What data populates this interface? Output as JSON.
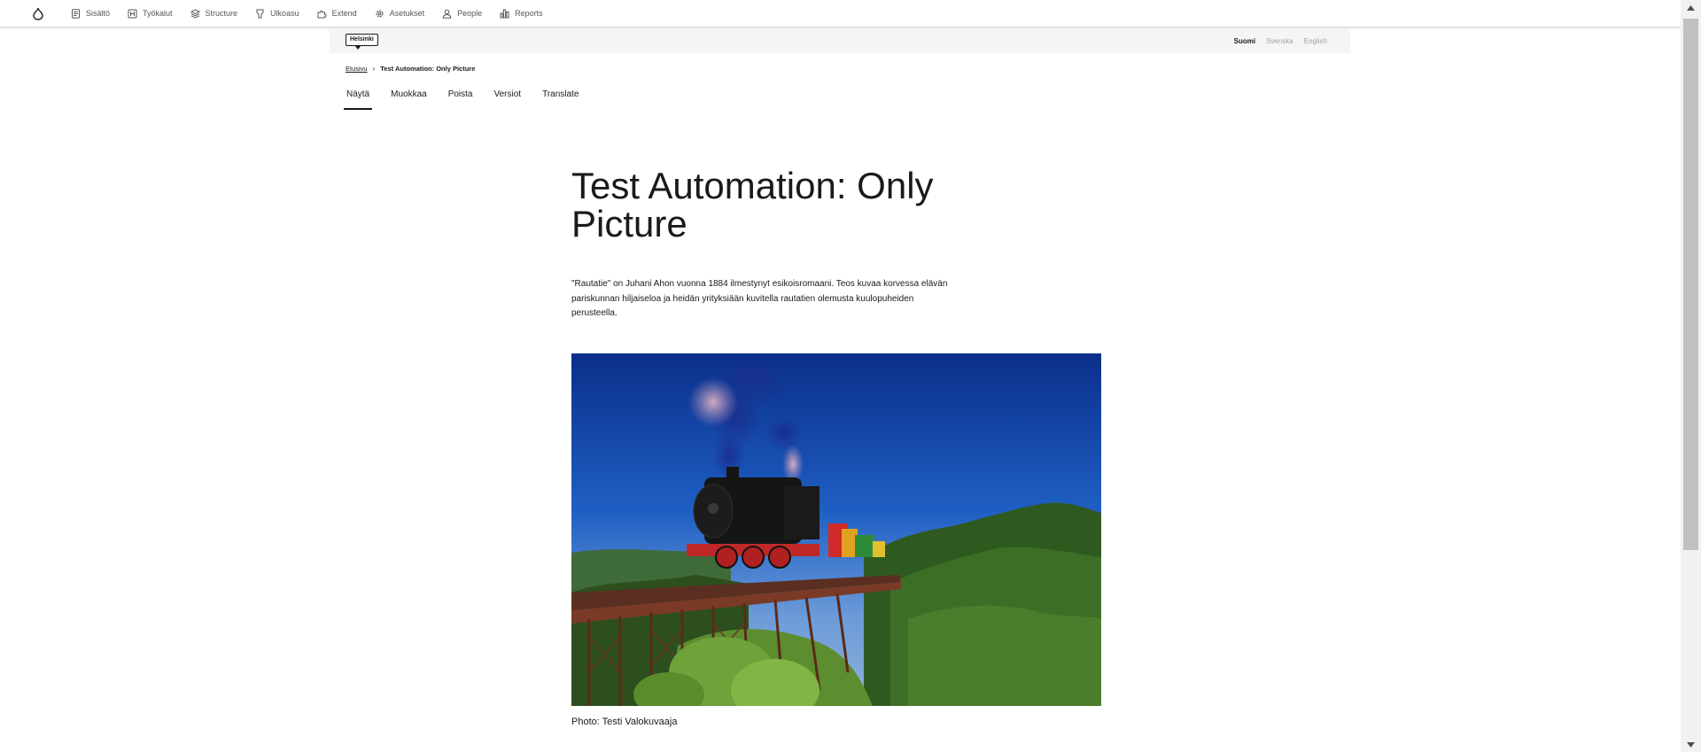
{
  "toolbar": {
    "items": [
      {
        "label": "Sisältö",
        "icon": "file-text-icon"
      },
      {
        "label": "Työkalut",
        "icon": "tools-icon"
      },
      {
        "label": "Structure",
        "icon": "structure-icon"
      },
      {
        "label": "Ulkoasu",
        "icon": "brush-icon"
      },
      {
        "label": "Extend",
        "icon": "puzzle-icon"
      },
      {
        "label": "Asetukset",
        "icon": "gear-icon"
      },
      {
        "label": "People",
        "icon": "person-icon"
      },
      {
        "label": "Reports",
        "icon": "bar-chart-icon"
      }
    ]
  },
  "site": {
    "brand": "Helsinki",
    "languages": [
      {
        "label": "Suomi",
        "active": true
      },
      {
        "label": "Svenska",
        "active": false
      },
      {
        "label": "English",
        "active": false
      }
    ]
  },
  "breadcrumb": {
    "home": "Etusivu",
    "current": "Test Automation: Only Picture"
  },
  "tabs": [
    {
      "label": "Näytä",
      "active": true
    },
    {
      "label": "Muokkaa",
      "active": false
    },
    {
      "label": "Poista",
      "active": false
    },
    {
      "label": "Versiot",
      "active": false
    },
    {
      "label": "Translate",
      "active": false
    }
  ],
  "page": {
    "title": "Test Automation: Only Picture",
    "lead": "\"Rautatie\" on Juhani Ahon vuonna 1884 ilmestynyt esikoisromaani. Teos kuvaa korvessa elävän pariskunnan hiljaiseloa ja heidän yrityksiään kuvitella rautatien olemusta kuulopuheiden perusteella.",
    "image_caption": "Photo: Testi Valokuvaaja"
  },
  "colors": {
    "text": "#1a1a1a",
    "toolbar_text": "#55565b",
    "site_bar": "#f5f5f5"
  }
}
